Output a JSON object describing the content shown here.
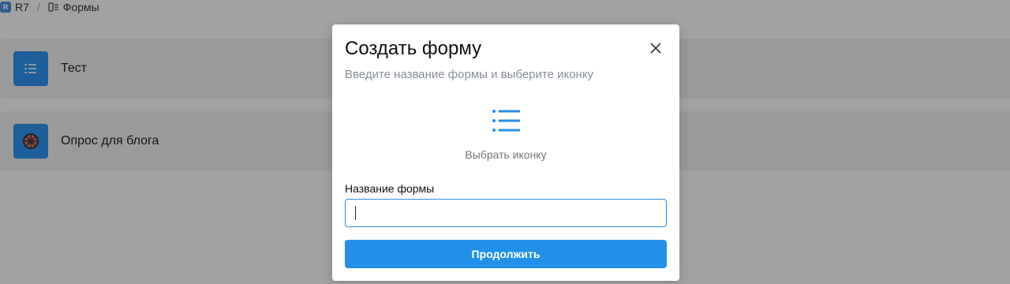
{
  "breadcrumb": {
    "app_badge": "R",
    "root": "R7",
    "separator": "/",
    "current": "Формы",
    "current_icon": "forms-icon"
  },
  "forms": [
    {
      "title": "Тест",
      "icon": "list-icon"
    },
    {
      "title": "Опрос для блога",
      "icon": "wheel-icon"
    }
  ],
  "modal": {
    "title": "Создать форму",
    "subtitle": "Введите название формы и выберите иконку",
    "icon_picker": {
      "icon": "list-icon",
      "label": "Выбрать иконку"
    },
    "name_field": {
      "label": "Название формы",
      "value": "",
      "placeholder": ""
    },
    "continue_label": "Продолжить",
    "close_icon": "close-icon"
  },
  "colors": {
    "accent": "#2290e8",
    "card_icon_bg": "#2a8ee6",
    "subtitle": "#888f99"
  }
}
